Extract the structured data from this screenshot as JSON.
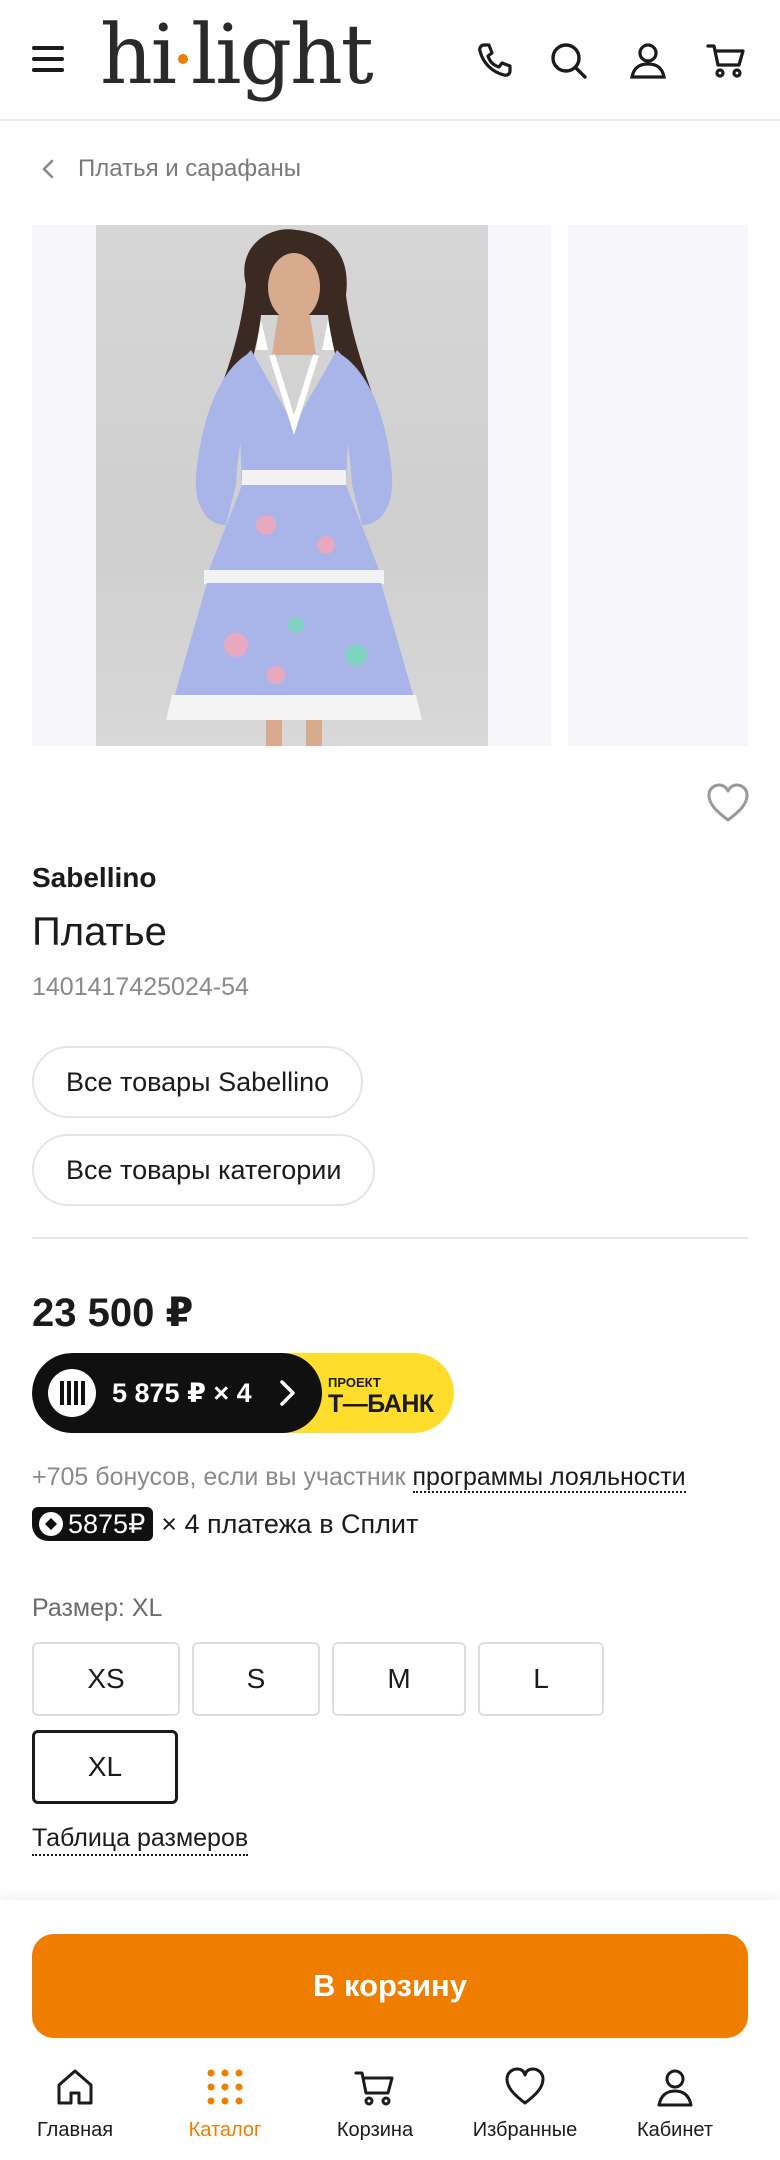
{
  "header": {
    "logo_text_left": "hi",
    "logo_text_right": "light",
    "icons": [
      "menu-icon",
      "phone-icon",
      "search-icon",
      "user-icon",
      "cart-icon"
    ]
  },
  "breadcrumb": {
    "label": "Платья и сарафаны"
  },
  "product": {
    "brand": "Sabellino",
    "title": "Платье",
    "sku": "1401417425024-54",
    "links": {
      "brand_all": "Все товары Sabellino",
      "category_all": "Все товары категории"
    },
    "price": "23 500 ₽",
    "installment": {
      "amount": "5 875 ₽ × 4",
      "project_label": "ПРОЕКТ",
      "bank_label": "Т—БАНК"
    },
    "bonus": {
      "prefix": "+705 бонусов, если вы участник ",
      "link": "программы лояльности"
    },
    "split": {
      "amount": "5875₽",
      "text": "× 4 платежа в Сплит"
    },
    "size": {
      "label": "Размер: XL",
      "options": [
        "XS",
        "S",
        "M",
        "L",
        "XL"
      ],
      "selected": "XL",
      "table_link": "Таблица размеров"
    }
  },
  "actions": {
    "add_to_cart": "В корзину"
  },
  "bottom_nav": {
    "items": [
      {
        "label": "Главная",
        "icon": "home-icon"
      },
      {
        "label": "Каталог",
        "icon": "catalog-icon",
        "active": true
      },
      {
        "label": "Корзина",
        "icon": "cart-icon"
      },
      {
        "label": "Избранные",
        "icon": "heart-icon"
      },
      {
        "label": "Кабинет",
        "icon": "user-icon"
      }
    ]
  },
  "colors": {
    "accent": "#ee7d00",
    "text": "#1b1b1b",
    "muted": "#8a8a8a",
    "tbank_yellow": "#ffdd2d",
    "dress": "#a9b4e8"
  }
}
